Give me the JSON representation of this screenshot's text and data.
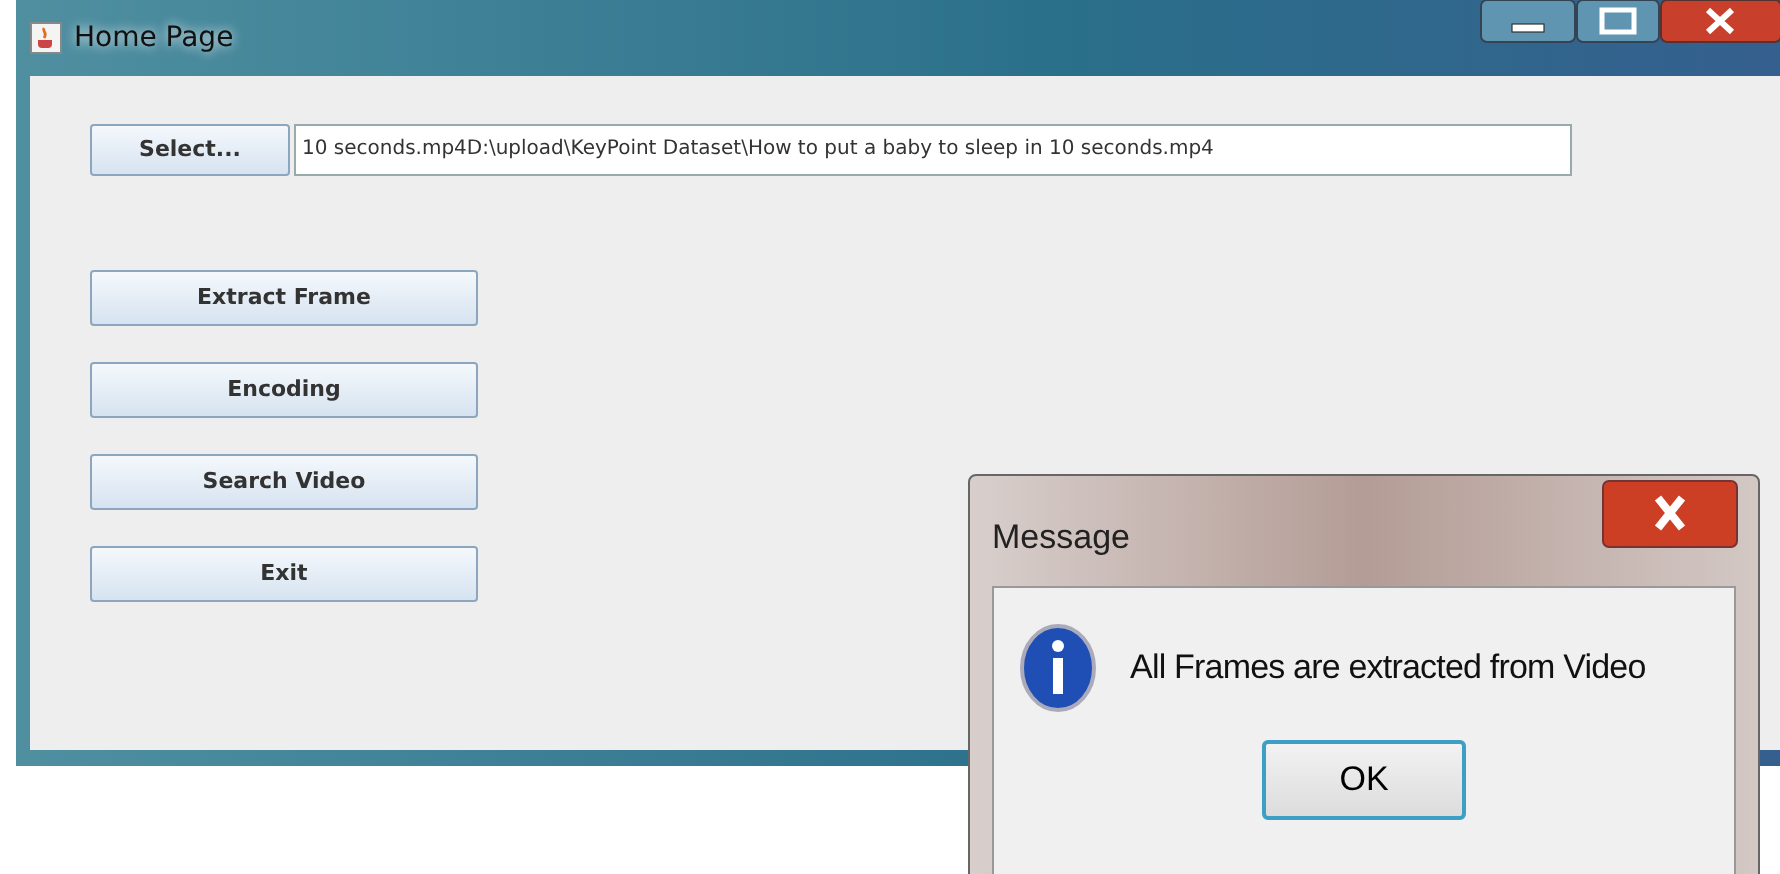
{
  "window": {
    "title": "Home Page"
  },
  "file_picker": {
    "button": "Select...",
    "value": "10 seconds.mp4D:\\upload\\KeyPoint Dataset\\How to put a baby to sleep in 10 seconds.mp4"
  },
  "actions": [
    "Extract Frame",
    "Encoding",
    "Search Video",
    "Exit"
  ],
  "dialog": {
    "title": "Message",
    "message": "All Frames are extracted from Video",
    "button": "OK"
  }
}
